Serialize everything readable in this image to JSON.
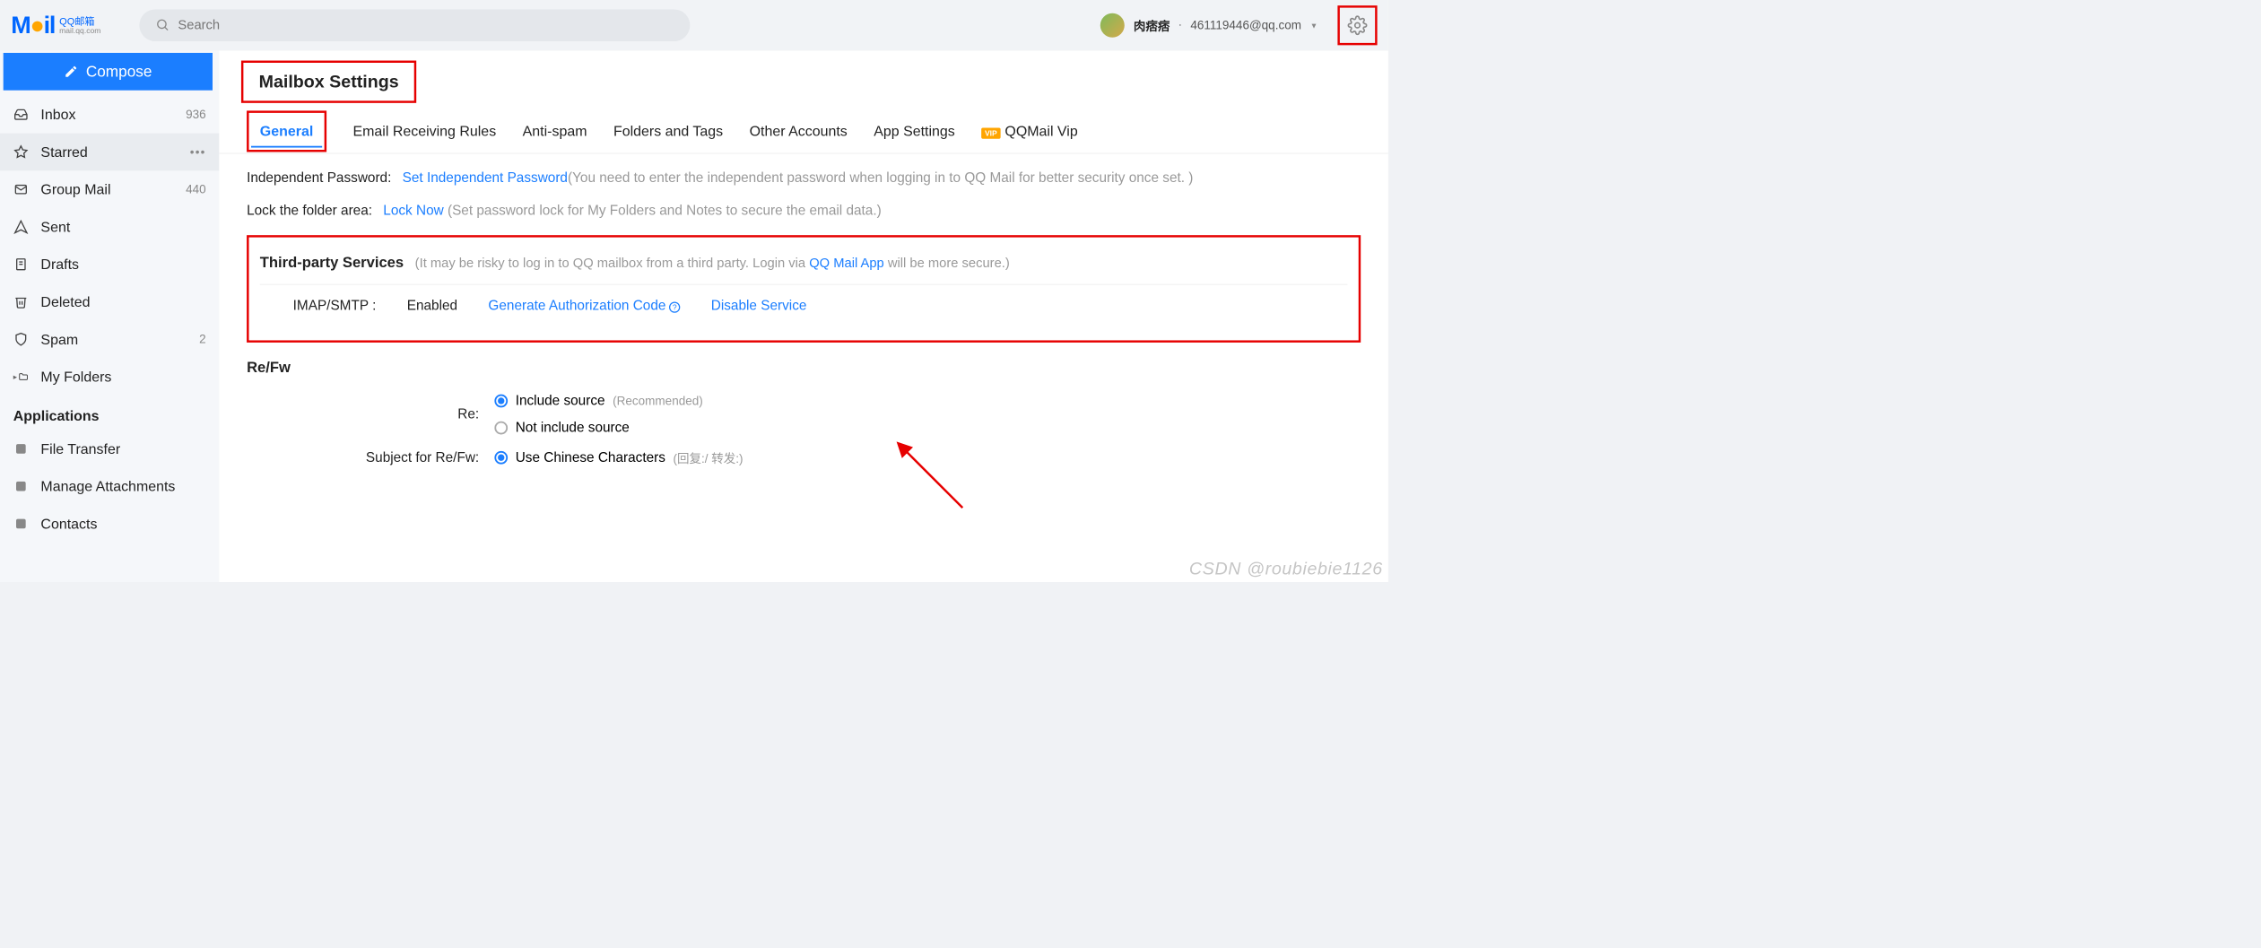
{
  "header": {
    "logo_text_1": "M",
    "logo_text_2": "il",
    "logo_cn": "QQ邮箱",
    "logo_domain": "mail.qq.com",
    "search_placeholder": "Search",
    "user_name": "肉痞痞",
    "user_email": "461119446@qq.com"
  },
  "compose_label": "Compose",
  "sidebar": {
    "items": [
      {
        "label": "Inbox",
        "count": "936"
      },
      {
        "label": "Starred",
        "count": ""
      },
      {
        "label": "Group Mail",
        "count": "440"
      },
      {
        "label": "Sent",
        "count": ""
      },
      {
        "label": "Drafts",
        "count": ""
      },
      {
        "label": "Deleted",
        "count": ""
      },
      {
        "label": "Spam",
        "count": "2"
      },
      {
        "label": "My Folders",
        "count": ""
      }
    ],
    "apps_header": "Applications",
    "apps": [
      {
        "label": "File Transfer"
      },
      {
        "label": "Manage Attachments"
      },
      {
        "label": "Contacts"
      }
    ]
  },
  "page_title": "Mailbox Settings",
  "tabs": [
    "General",
    "Email Receiving Rules",
    "Anti-spam",
    "Folders and Tags",
    "Other Accounts",
    "App Settings",
    "QQMail Vip"
  ],
  "settings": {
    "indep_label": "Independent Password:",
    "indep_link": "Set Independent Password",
    "indep_hint": "(You need to enter the independent password when logging in to QQ Mail for better security once set. )",
    "lock_label": "Lock the folder area:",
    "lock_link": "Lock Now",
    "lock_hint": "(Set password lock for My Folders and Notes to secure the email data.)",
    "tps_title": "Third-party Services",
    "tps_hint_1": "(It may be risky to log in to QQ mailbox from a third party. Login via ",
    "tps_link": "QQ Mail App",
    "tps_hint_2": " will be more secure.)",
    "imap_label": "IMAP/SMTP :",
    "imap_status": "Enabled",
    "imap_gen": "Generate Authorization Code",
    "imap_disable": "Disable Service",
    "refw_title": "Re/Fw",
    "re_label": "Re:",
    "re_opt1": "Include source",
    "re_rec": "(Recommended)",
    "re_opt2": "Not include source",
    "subj_label": "Subject for Re/Fw:",
    "subj_opt1": "Use Chinese Characters",
    "subj_cn": "(回复:/ 转发:)"
  },
  "watermark": "CSDN @roubiebie1126"
}
